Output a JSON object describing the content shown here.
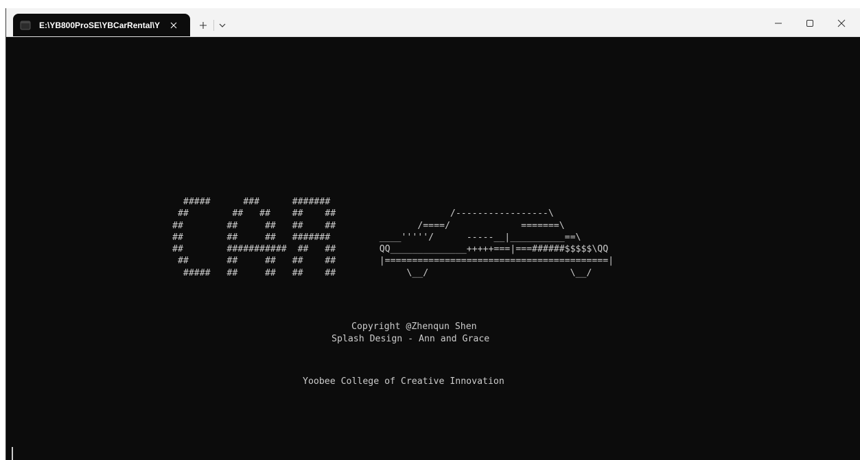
{
  "window": {
    "tab_title": "E:\\YB800ProSE\\YBCarRental\\Y",
    "icons": {
      "tab": "terminal-icon",
      "close_tab": "close-icon",
      "new_tab": "plus-icon",
      "dropdown": "chevron-down-icon",
      "minimize": "minimize-icon",
      "maximize": "maximize-icon",
      "close_window": "close-icon"
    }
  },
  "terminal": {
    "ascii_art": [
      "  #####      ###      #######",
      " ##        ##   ##    ##    ##                     /-----------------\\",
      "##        ##     ##   ##    ##               /====/             =======\\",
      "##        ##     ##   #######         ____'''''/      -----__|__________==\\",
      "##        ###########  ##   ##        QQ______________+++++===|===######$$$$$\\QQ",
      " ##       ##     ##   ##    ##        |=========================================|",
      "  #####   ##     ##   ##    ##             \\__/                          \\__/"
    ],
    "copyright": "Copyright @Zhenqun Shen",
    "splash_design": "Splash Design - Ann and Grace",
    "college": "Yoobee College of Creative Innovation"
  },
  "colors": {
    "background": "#0c0c0c",
    "text": "#cccccc",
    "titlebar": "#f3f3f3"
  }
}
